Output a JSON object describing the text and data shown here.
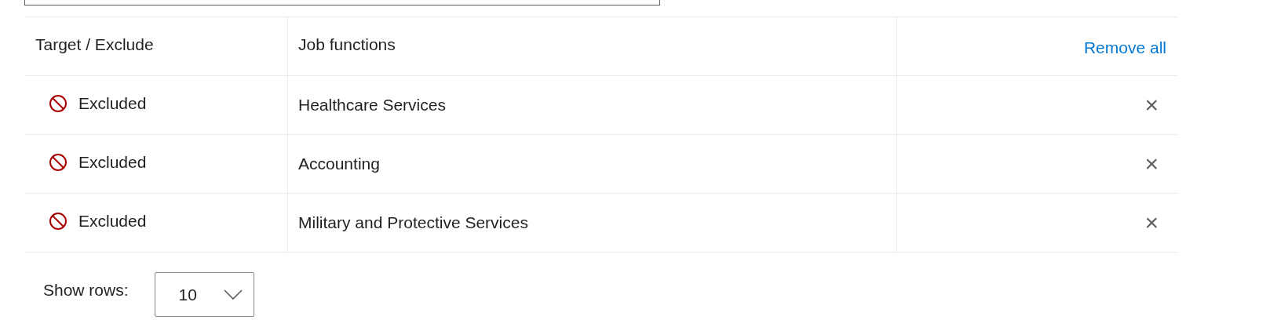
{
  "table": {
    "columns": [
      "Target / Exclude",
      "Job functions"
    ],
    "remove_all": "Remove all",
    "rows": [
      {
        "kind": "excluded",
        "status_label": "Excluded",
        "job_function": "Healthcare Services",
        "remove": "×"
      },
      {
        "kind": "excluded",
        "status_label": "Excluded",
        "job_function": "Accounting",
        "remove": "×"
      },
      {
        "kind": "excluded",
        "status_label": "Excluded",
        "job_function": "Military and Protective Services",
        "remove": "×"
      }
    ]
  },
  "pagination": {
    "label": "Show rows:",
    "value": "10"
  }
}
